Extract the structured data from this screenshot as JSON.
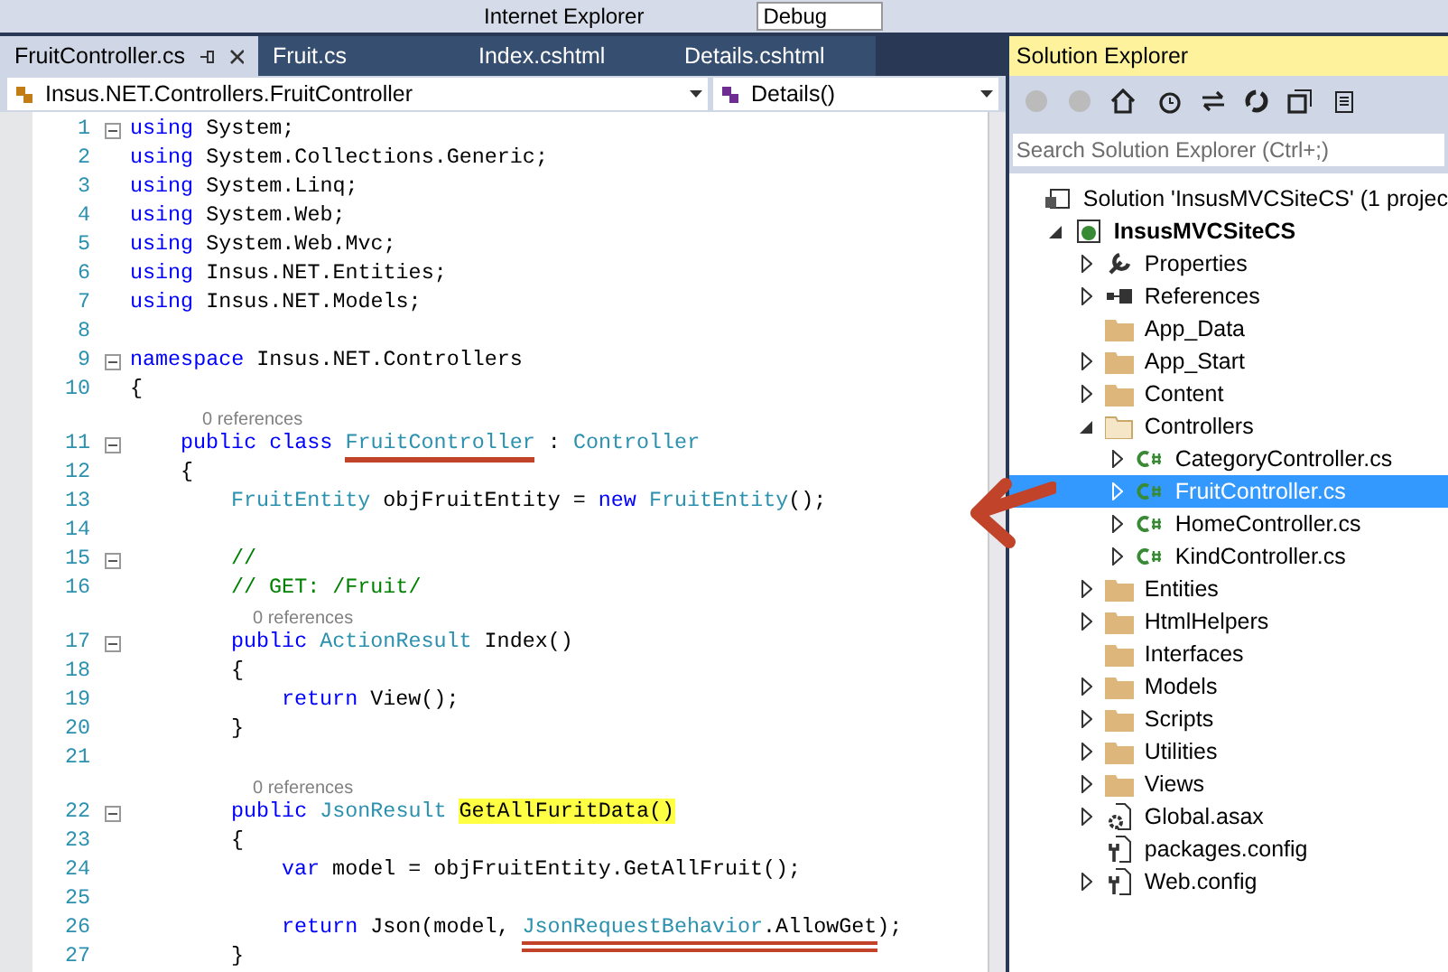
{
  "toolbar": {
    "run_target": "Internet Explorer",
    "configuration": "Debug"
  },
  "editor": {
    "tabs": [
      {
        "label": "FruitController.cs",
        "selected": true,
        "pinned": true
      },
      {
        "label": "Fruit.cs",
        "selected": false,
        "pinned": false
      },
      {
        "label": "Index.cshtml",
        "selected": false,
        "pinned": false
      },
      {
        "label": "Details.cshtml",
        "selected": false,
        "pinned": false
      }
    ],
    "nav_bar": {
      "type_dropdown": "Insus.NET.Controllers.FruitController",
      "member_dropdown": "Details()"
    },
    "lines": [
      {
        "n": "1",
        "fold": true,
        "segs": [
          {
            "kind": "kw",
            "text": "using"
          },
          {
            "kind": "plain",
            "text": " System;"
          }
        ]
      },
      {
        "n": "2",
        "segs": [
          {
            "kind": "kw",
            "text": "using"
          },
          {
            "kind": "plain",
            "text": " System.Collections.Generic;"
          }
        ]
      },
      {
        "n": "3",
        "segs": [
          {
            "kind": "kw",
            "text": "using"
          },
          {
            "kind": "plain",
            "text": " System.Linq;"
          }
        ]
      },
      {
        "n": "4",
        "segs": [
          {
            "kind": "kw",
            "text": "using"
          },
          {
            "kind": "plain",
            "text": " System.Web;"
          }
        ]
      },
      {
        "n": "5",
        "segs": [
          {
            "kind": "kw",
            "text": "using"
          },
          {
            "kind": "plain",
            "text": " System.Web.Mvc;"
          }
        ]
      },
      {
        "n": "6",
        "segs": [
          {
            "kind": "kw",
            "text": "using"
          },
          {
            "kind": "plain",
            "text": " Insus.NET.Entities;"
          }
        ]
      },
      {
        "n": "7",
        "segs": [
          {
            "kind": "kw",
            "text": "using"
          },
          {
            "kind": "plain",
            "text": " Insus.NET.Models;"
          }
        ]
      },
      {
        "n": "8"
      },
      {
        "n": "9",
        "fold": true,
        "segs": [
          {
            "kind": "kw",
            "text": "namespace"
          },
          {
            "kind": "plain",
            "text": " Insus.NET.Controllers"
          }
        ]
      },
      {
        "n": "10",
        "segs": [
          {
            "kind": "plain",
            "text": "{"
          }
        ]
      },
      {
        "n": "11",
        "fold": true,
        "lens": "0 references",
        "segs": [
          {
            "kind": "kw",
            "text": "public class "
          },
          {
            "kind": "type",
            "text": "FruitController",
            "underlined": true
          },
          {
            "kind": "plain",
            "text": " : "
          },
          {
            "kind": "type",
            "text": "Controller"
          }
        ]
      },
      {
        "n": "12",
        "segs": [
          {
            "kind": "plain",
            "text": "{"
          }
        ]
      },
      {
        "n": "13",
        "segs": [
          {
            "kind": "type",
            "text": "FruitEntity"
          },
          {
            "kind": "plain",
            "text": " objFruitEntity = "
          },
          {
            "kind": "kw",
            "text": "new "
          },
          {
            "kind": "type",
            "text": "FruitEntity"
          },
          {
            "kind": "plain",
            "text": "();"
          }
        ]
      },
      {
        "n": "14"
      },
      {
        "n": "15",
        "fold": true,
        "segs": [
          {
            "kind": "comment",
            "text": "//"
          }
        ]
      },
      {
        "n": "16",
        "segs": [
          {
            "kind": "comment",
            "text": "// GET: /Fruit/"
          }
        ]
      },
      {
        "n": "17",
        "fold": true,
        "lens": "0 references",
        "segs": [
          {
            "kind": "kw",
            "text": "public "
          },
          {
            "kind": "type",
            "text": "ActionResult"
          },
          {
            "kind": "plain",
            "text": " Index()"
          }
        ]
      },
      {
        "n": "18",
        "segs": [
          {
            "kind": "plain",
            "text": "{"
          }
        ]
      },
      {
        "n": "19",
        "segs": [
          {
            "kind": "kw",
            "text": "return"
          },
          {
            "kind": "plain",
            "text": " View();"
          }
        ]
      },
      {
        "n": "20",
        "segs": [
          {
            "kind": "plain",
            "text": "}"
          }
        ]
      },
      {
        "n": "21"
      },
      {
        "n": "22",
        "fold": true,
        "lens": "0 references",
        "segs": [
          {
            "kind": "kw",
            "text": "public "
          },
          {
            "kind": "type",
            "text": "JsonResult "
          },
          {
            "kind": "plain",
            "text": "GetAllFuritData()",
            "highlighted": true
          }
        ]
      },
      {
        "n": "23",
        "segs": [
          {
            "kind": "plain",
            "text": "{"
          }
        ]
      },
      {
        "n": "24",
        "segs": [
          {
            "kind": "kw",
            "text": "var"
          },
          {
            "kind": "plain",
            "text": " model = objFruitEntity.GetAllFruit();"
          }
        ]
      },
      {
        "n": "25"
      },
      {
        "n": "26",
        "segs": [
          {
            "kind": "kw",
            "text": "return"
          },
          {
            "kind": "plain",
            "text": " Json(model, "
          },
          {
            "kind": "type",
            "text": "JsonRequestBehavior",
            "double_underlined": true
          },
          {
            "kind": "plain",
            "text": ".AllowGet",
            "double_underlined": true
          },
          {
            "kind": "plain",
            "text": ");"
          }
        ]
      },
      {
        "n": "27",
        "segs": [
          {
            "kind": "plain",
            "text": "}"
          }
        ]
      }
    ]
  },
  "solution_explorer": {
    "title": "Solution Explorer",
    "search": {
      "placeholder": "Search Solution Explorer (Ctrl+;)"
    },
    "tree": [
      {
        "label": "Solution 'InsusMVCSiteCS' (1 projec",
        "kind": "solution",
        "selected": false,
        "children": [
          {
            "label": "InsusMVCSiteCS",
            "kind": "project",
            "bold": true,
            "expanded": true,
            "selected": false,
            "children": [
              {
                "label": "Properties",
                "kind": "wrench",
                "expanded": false,
                "selected": false
              },
              {
                "label": "References",
                "kind": "references",
                "expanded": false,
                "selected": false
              },
              {
                "label": "App_Data",
                "kind": "folder",
                "selected": false
              },
              {
                "label": "App_Start",
                "kind": "folder",
                "expanded": false,
                "selected": false
              },
              {
                "label": "Content",
                "kind": "folder",
                "expanded": false,
                "selected": false
              },
              {
                "label": "Controllers",
                "kind": "folder-open",
                "expanded": true,
                "selected": false,
                "children": [
                  {
                    "label": "CategoryController.cs",
                    "kind": "csharp",
                    "expanded": false,
                    "selected": false
                  },
                  {
                    "label": "FruitController.cs",
                    "kind": "csharp",
                    "expanded": false,
                    "selected": true
                  },
                  {
                    "label": "HomeController.cs",
                    "kind": "csharp",
                    "expanded": false,
                    "selected": false
                  },
                  {
                    "label": "KindController.cs",
                    "kind": "csharp",
                    "expanded": false,
                    "selected": false
                  }
                ]
              },
              {
                "label": "Entities",
                "kind": "folder",
                "expanded": false,
                "selected": false
              },
              {
                "label": "HtmlHelpers",
                "kind": "folder",
                "expanded": false,
                "selected": false
              },
              {
                "label": "Interfaces",
                "kind": "folder",
                "selected": false
              },
              {
                "label": "Models",
                "kind": "folder",
                "expanded": false,
                "selected": false
              },
              {
                "label": "Scripts",
                "kind": "folder",
                "expanded": false,
                "selected": false
              },
              {
                "label": "Utilities",
                "kind": "folder",
                "expanded": false,
                "selected": false
              },
              {
                "label": "Views",
                "kind": "folder",
                "expanded": false,
                "selected": false
              },
              {
                "label": "Global.asax",
                "kind": "asax",
                "expanded": false,
                "selected": false
              },
              {
                "label": "packages.config",
                "kind": "config",
                "selected": false
              },
              {
                "label": "Web.config",
                "kind": "config",
                "expanded": false,
                "selected": false
              }
            ]
          }
        ]
      }
    ]
  }
}
